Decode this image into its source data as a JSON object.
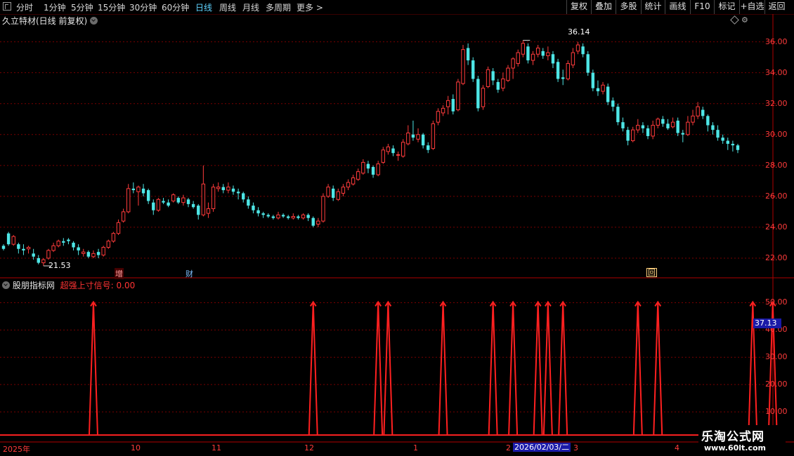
{
  "toolbar": {
    "periods": [
      "分时",
      "1分钟",
      "5分钟",
      "15分钟",
      "30分钟",
      "60分钟",
      "日线",
      "周线",
      "月线",
      "多周期",
      "更多 >"
    ],
    "active_period": "日线",
    "buttons": [
      "复权",
      "叠加",
      "多股",
      "统计",
      "画线",
      "F10",
      "+自选",
      "返回"
    ],
    "label_button": "标记"
  },
  "stock_title": "久立特材(日线 前复权)",
  "indicator": {
    "name": "股朋指标网",
    "signal_label": "超强上寸信号: 0.00"
  },
  "price_axis": [
    "36.00",
    "34.00",
    "32.00",
    "30.00",
    "28.00",
    "26.00",
    "24.00",
    "22.00"
  ],
  "indicator_axis": [
    "50.00",
    "40.00",
    "30.00",
    "20.00",
    "10.00"
  ],
  "current_value": "37.13",
  "high_label": "36.14",
  "low_label": "21.53",
  "markers": {
    "zeng": "增",
    "cai": "财",
    "hui": "回"
  },
  "date_axis": {
    "labels": [
      "2025年",
      "10",
      "11",
      "12",
      "1",
      "2",
      "3",
      "4"
    ],
    "selected": "2026/02/03/二"
  },
  "watermark": {
    "line1": "乐淘公式网",
    "line2": "www.60lt.com"
  },
  "colors": {
    "up": "#ff3b3b",
    "down": "#4ee6e6",
    "grid": "#7a0000",
    "signal": "#ff2020",
    "active": "#5fd3ff"
  },
  "chart_data": {
    "type": "candlestick",
    "price_range": [
      21,
      36.8
    ],
    "candles": [
      [
        22.8,
        22.6,
        22.9,
        22.5
      ],
      [
        23.6,
        22.9,
        23.7,
        22.8
      ],
      [
        22.9,
        23.4,
        23.5,
        22.8
      ],
      [
        22.9,
        22.6,
        23.0,
        22.3
      ],
      [
        22.6,
        22.5,
        22.9,
        22.2
      ],
      [
        22.6,
        22.7,
        22.8,
        22.3
      ],
      [
        22.3,
        22.1,
        22.6,
        21.9
      ],
      [
        22.0,
        21.7,
        22.2,
        21.6
      ],
      [
        21.7,
        21.9,
        22.0,
        21.5
      ],
      [
        22.0,
        22.5,
        22.6,
        21.9
      ],
      [
        22.5,
        22.8,
        23.0,
        22.4
      ],
      [
        22.8,
        23.1,
        23.2,
        22.7
      ],
      [
        23.1,
        23.0,
        23.3,
        22.8
      ],
      [
        23.2,
        23.1,
        23.3,
        22.9
      ],
      [
        23.0,
        22.7,
        23.1,
        22.5
      ],
      [
        22.7,
        22.5,
        22.9,
        22.2
      ],
      [
        22.3,
        22.4,
        22.6,
        22.1
      ],
      [
        22.4,
        22.1,
        22.5,
        22.0
      ],
      [
        22.1,
        22.3,
        22.5,
        22.0
      ],
      [
        22.4,
        22.2,
        22.6,
        22.0
      ],
      [
        22.2,
        22.7,
        22.8,
        22.1
      ],
      [
        22.7,
        23.1,
        23.2,
        22.6
      ],
      [
        23.1,
        23.6,
        23.7,
        23.0
      ],
      [
        23.6,
        24.3,
        24.5,
        23.5
      ],
      [
        24.4,
        25.0,
        25.2,
        24.3
      ],
      [
        25.0,
        26.5,
        26.8,
        24.9
      ],
      [
        26.5,
        26.4,
        26.9,
        26.2
      ],
      [
        26.3,
        26.6,
        26.7,
        25.4
      ],
      [
        26.5,
        26.2,
        26.8,
        26.0
      ],
      [
        26.4,
        25.7,
        26.5,
        25.5
      ],
      [
        25.6,
        25.1,
        25.8,
        24.8
      ],
      [
        25.1,
        25.8,
        25.9,
        25.0
      ],
      [
        25.7,
        25.6,
        25.9,
        25.5
      ],
      [
        25.6,
        25.4,
        25.8,
        25.3
      ],
      [
        25.7,
        26.1,
        26.2,
        25.6
      ],
      [
        25.9,
        25.6,
        26.0,
        25.5
      ],
      [
        25.6,
        25.9,
        26.1,
        25.4
      ],
      [
        25.8,
        25.5,
        25.9,
        25.3
      ],
      [
        25.5,
        25.3,
        25.7,
        25.2
      ],
      [
        25.4,
        24.8,
        25.5,
        24.5
      ],
      [
        24.8,
        26.8,
        28.0,
        24.7
      ],
      [
        24.9,
        25.2,
        25.6,
        24.6
      ],
      [
        25.2,
        26.6,
        26.8,
        25.0
      ],
      [
        26.5,
        26.6,
        26.9,
        26.3
      ],
      [
        26.6,
        26.4,
        26.8,
        26.2
      ],
      [
        26.4,
        26.6,
        26.9,
        26.2
      ],
      [
        26.5,
        26.3,
        26.7,
        26.1
      ],
      [
        26.3,
        26.2,
        26.5,
        25.8
      ],
      [
        26.2,
        25.8,
        26.3,
        25.6
      ],
      [
        25.8,
        25.4,
        26.0,
        25.2
      ],
      [
        25.4,
        25.1,
        25.6,
        24.9
      ],
      [
        25.1,
        24.9,
        25.3,
        24.7
      ],
      [
        24.9,
        24.8,
        25.0,
        24.6
      ],
      [
        24.8,
        24.7,
        24.9,
        24.6
      ],
      [
        24.7,
        24.6,
        24.8,
        24.5
      ],
      [
        24.6,
        24.8,
        25.0,
        24.5
      ],
      [
        24.8,
        24.7,
        24.9,
        24.6
      ],
      [
        24.7,
        24.6,
        24.8,
        24.5
      ],
      [
        24.6,
        24.7,
        24.9,
        24.5
      ],
      [
        24.7,
        24.6,
        24.8,
        24.5
      ],
      [
        24.6,
        24.8,
        24.9,
        24.5
      ],
      [
        24.8,
        24.6,
        24.9,
        24.4
      ],
      [
        24.6,
        24.1,
        24.7,
        24.0
      ],
      [
        24.2,
        24.4,
        24.6,
        24.0
      ],
      [
        24.4,
        26.0,
        26.2,
        24.3
      ],
      [
        26.0,
        26.6,
        26.8,
        25.9
      ],
      [
        26.5,
        25.9,
        26.7,
        25.7
      ],
      [
        25.8,
        26.3,
        26.5,
        25.7
      ],
      [
        26.2,
        26.6,
        26.8,
        26.0
      ],
      [
        26.6,
        26.9,
        27.1,
        26.4
      ],
      [
        26.8,
        27.2,
        27.4,
        26.7
      ],
      [
        27.1,
        27.6,
        27.8,
        27.0
      ],
      [
        27.5,
        28.2,
        28.4,
        27.4
      ],
      [
        28.1,
        27.8,
        28.3,
        27.5
      ],
      [
        27.9,
        27.4,
        28.0,
        27.2
      ],
      [
        27.4,
        28.1,
        28.3,
        27.3
      ],
      [
        28.2,
        29.0,
        29.2,
        28.1
      ],
      [
        28.9,
        29.2,
        29.4,
        28.7
      ],
      [
        29.1,
        28.8,
        29.3,
        28.6
      ],
      [
        28.7,
        28.7,
        28.9,
        28.3
      ],
      [
        28.6,
        29.5,
        29.7,
        28.5
      ],
      [
        29.4,
        30.1,
        30.6,
        29.3
      ],
      [
        30.0,
        29.8,
        30.9,
        29.6
      ],
      [
        29.7,
        30.0,
        30.4,
        29.5
      ],
      [
        30.0,
        29.3,
        30.1,
        29.1
      ],
      [
        29.3,
        29.0,
        29.5,
        28.8
      ],
      [
        29.1,
        30.7,
        30.9,
        29.0
      ],
      [
        30.8,
        31.5,
        31.7,
        30.6
      ],
      [
        31.4,
        31.7,
        31.9,
        31.2
      ],
      [
        31.8,
        32.2,
        32.5,
        31.3
      ],
      [
        32.3,
        31.5,
        32.6,
        31.3
      ],
      [
        31.6,
        33.4,
        33.6,
        31.5
      ],
      [
        33.3,
        35.5,
        35.8,
        33.2
      ],
      [
        35.6,
        34.8,
        35.9,
        34.5
      ],
      [
        34.8,
        33.6,
        35.0,
        33.4
      ],
      [
        33.6,
        31.7,
        33.8,
        31.5
      ],
      [
        31.8,
        33.0,
        33.2,
        31.6
      ],
      [
        33.1,
        34.2,
        34.4,
        33.0
      ],
      [
        34.1,
        33.5,
        34.3,
        33.2
      ],
      [
        33.4,
        32.9,
        33.6,
        32.7
      ],
      [
        33.0,
        33.6,
        34.0,
        32.8
      ],
      [
        33.5,
        34.3,
        34.5,
        33.4
      ],
      [
        34.3,
        34.9,
        35.0,
        33.6
      ],
      [
        34.6,
        35.3,
        35.5,
        34.4
      ],
      [
        35.2,
        35.9,
        36.1,
        35.0
      ],
      [
        35.7,
        34.8,
        35.9,
        34.6
      ],
      [
        34.8,
        35.2,
        35.4,
        34.5
      ],
      [
        35.2,
        35.6,
        35.8,
        35.0
      ],
      [
        35.4,
        35.1,
        35.6,
        34.9
      ],
      [
        35.1,
        35.3,
        35.7,
        34.8
      ],
      [
        35.2,
        34.6,
        35.4,
        34.3
      ],
      [
        34.7,
        33.6,
        34.9,
        33.4
      ],
      [
        33.7,
        33.6,
        34.2,
        33.2
      ],
      [
        33.6,
        34.6,
        34.8,
        33.5
      ],
      [
        34.5,
        35.3,
        35.6,
        34.3
      ],
      [
        35.4,
        35.8,
        36.0,
        35.2
      ],
      [
        35.7,
        35.2,
        35.9,
        35.0
      ],
      [
        35.2,
        34.0,
        35.4,
        33.8
      ],
      [
        34.0,
        33.0,
        34.2,
        32.8
      ],
      [
        33.0,
        32.8,
        33.5,
        32.5
      ],
      [
        32.8,
        33.2,
        33.4,
        32.6
      ],
      [
        33.1,
        32.1,
        33.3,
        31.9
      ],
      [
        32.2,
        31.8,
        32.4,
        31.5
      ],
      [
        31.8,
        30.8,
        32.0,
        30.6
      ],
      [
        30.8,
        30.4,
        31.1,
        30.2
      ],
      [
        30.3,
        29.6,
        30.5,
        29.3
      ],
      [
        29.6,
        30.3,
        30.5,
        29.5
      ],
      [
        30.3,
        30.6,
        31.0,
        30.1
      ],
      [
        30.6,
        30.4,
        30.8,
        30.1
      ],
      [
        30.4,
        29.9,
        30.6,
        29.7
      ],
      [
        29.9,
        30.6,
        30.9,
        29.7
      ],
      [
        30.6,
        31.0,
        31.1,
        30.4
      ],
      [
        31.0,
        30.7,
        31.2,
        30.5
      ],
      [
        30.7,
        30.4,
        31.0,
        30.3
      ],
      [
        30.5,
        30.8,
        31.1,
        30.4
      ],
      [
        30.9,
        30.1,
        31.1,
        29.9
      ],
      [
        30.1,
        30.0,
        30.3,
        29.5
      ],
      [
        30.0,
        30.8,
        31.2,
        29.9
      ],
      [
        30.8,
        31.2,
        31.6,
        30.6
      ],
      [
        31.2,
        31.8,
        32.1,
        31.0
      ],
      [
        31.6,
        31.2,
        31.8,
        31.0
      ],
      [
        31.2,
        30.6,
        31.3,
        30.2
      ],
      [
        30.6,
        30.3,
        30.8,
        30.0
      ],
      [
        30.3,
        29.8,
        30.6,
        29.6
      ],
      [
        29.8,
        29.6,
        30.0,
        29.4
      ],
      [
        29.6,
        29.4,
        29.8,
        29.0
      ],
      [
        29.4,
        29.3,
        29.6,
        28.9
      ],
      [
        29.3,
        29.0,
        29.4,
        28.8
      ]
    ],
    "signals_x_index": [
      18,
      62,
      75,
      77,
      88,
      98,
      102,
      107,
      109,
      112,
      127,
      131,
      150,
      154
    ],
    "signal_peak": 50,
    "signal_range": [
      0,
      55
    ]
  }
}
